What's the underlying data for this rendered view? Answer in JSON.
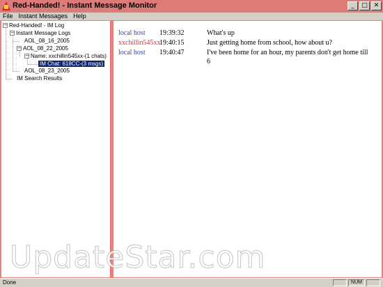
{
  "window": {
    "title": "Red-Handed! - Instant Message Monitor",
    "minimize_label": "_",
    "maximize_label": "□",
    "close_label": "✕"
  },
  "menu": {
    "file": "File",
    "instant_messages": "Instant Messages",
    "help": "Help"
  },
  "tree": {
    "root": "Red-Handed! - IM Log",
    "im_logs": "Instant Message Logs",
    "aol1": "AOL_08_16_2005",
    "aol2": "AOL_08_22_2005",
    "name_node": "Name: xxchillin545xx-(1 chats)",
    "im_chat": "IM Chat: 618CC-(3 msgs)",
    "aol3": "AOL_08_23_2005",
    "search_results": "IM Search Results",
    "expand_glyph": "−"
  },
  "chat": {
    "messages": [
      {
        "sender": "local host",
        "time": "19:39:32",
        "text": "What's up",
        "role": "local"
      },
      {
        "sender": "xxchillin545xx",
        "time": "19:40:15",
        "text": "Just getting home from school, how about u?",
        "role": "remote"
      },
      {
        "sender": "local host",
        "time": "19:40:47",
        "text": "I've been home for an hour, my parents don't get home till 6",
        "role": "local"
      }
    ]
  },
  "watermark": "UpdateStar.com",
  "status": {
    "text": "Done",
    "num": "NUM"
  },
  "colors": {
    "accent": "#e8827f",
    "selection": "#0a246a",
    "local_sender": "#2f3fb5",
    "remote_sender": "#d23a3a"
  }
}
